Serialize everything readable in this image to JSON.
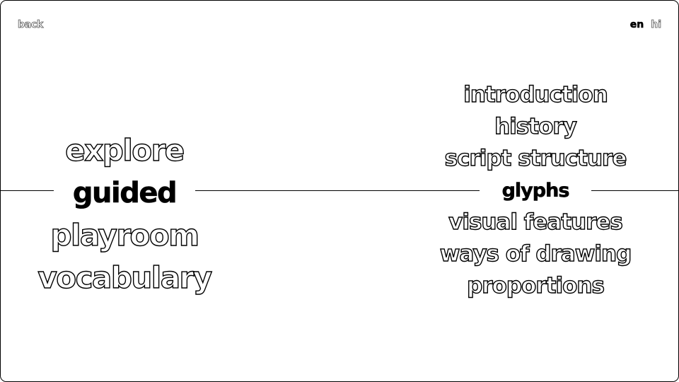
{
  "nav": {
    "back_label": "back",
    "languages": [
      {
        "label": "en",
        "active": true
      },
      {
        "label": "hi",
        "active": false
      }
    ]
  },
  "modes": {
    "selected": "guided",
    "items": [
      "explore",
      "guided",
      "playroom",
      "vocabulary"
    ]
  },
  "topics": {
    "selected": "glyphs",
    "items": [
      "introduction",
      "history",
      "script structure",
      "glyphs",
      "visual features",
      "ways of drawing",
      "proportions"
    ]
  }
}
